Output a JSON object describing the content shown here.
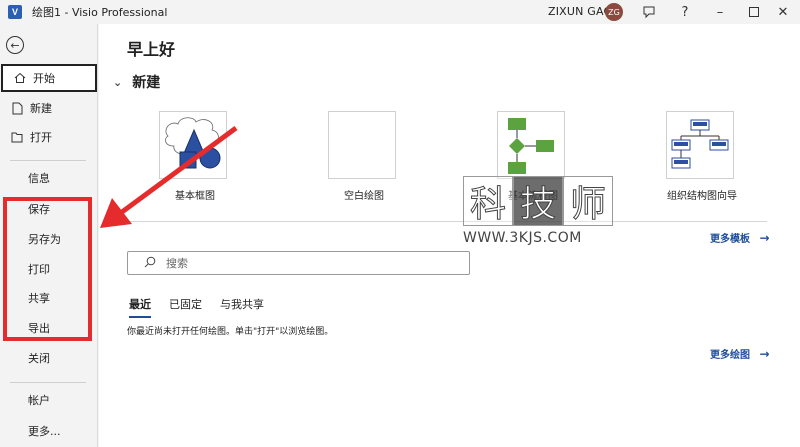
{
  "titlebar": {
    "logo": "V",
    "title": "绘图1  -  Visio Professional",
    "user_name": "ZIXUN GAO",
    "avatar_initials": "ZG",
    "icons": [
      "feedback-icon",
      "help-icon",
      "minimize-icon",
      "maximize-icon",
      "close-icon"
    ]
  },
  "sidebar": {
    "back_icon": "back-arrow-icon",
    "items_top": [
      {
        "label": "开始",
        "icon": "home-icon",
        "active": true
      },
      {
        "label": "新建",
        "icon": "new-file-icon"
      },
      {
        "label": "打开",
        "icon": "open-folder-icon"
      }
    ],
    "items_mid": [
      "信息",
      "保存",
      "另存为",
      "打印",
      "共享",
      "导出",
      "关闭"
    ],
    "items_bottom": [
      "帐户",
      "更多..."
    ]
  },
  "main": {
    "greeting": "早上好",
    "new_heading": "新建",
    "templates": [
      {
        "label": "基本框图"
      },
      {
        "label": "空白绘图"
      },
      {
        "label": "基本流程图"
      },
      {
        "label": "组织结构图向导"
      }
    ],
    "more_templates": "更多模板",
    "search_placeholder": "搜索",
    "tabs": [
      {
        "label": "最近",
        "active": true
      },
      {
        "label": "已固定"
      },
      {
        "label": "与我共享"
      }
    ],
    "empty_message": "你最近尚未打开任何绘图。单击\"打开\"以浏览绘图。",
    "more_drawings": "更多绘图"
  },
  "watermark": {
    "chars": [
      "科",
      "技",
      "师"
    ],
    "url": "WWW.3KJS.COM"
  },
  "colors": {
    "accent": "#1f4e9a",
    "annotation_red": "#e52b2b",
    "avatar": "#8a4a3e"
  }
}
